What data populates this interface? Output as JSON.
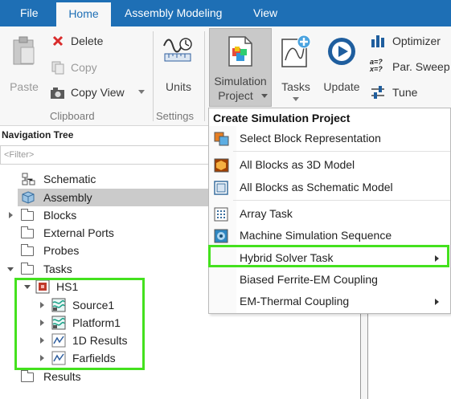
{
  "menubar": {
    "file": "File",
    "home": "Home",
    "assembly_modeling": "Assembly Modeling",
    "view": "View"
  },
  "ribbon": {
    "paste": "Paste",
    "delete": "Delete",
    "copy": "Copy",
    "copy_view": "Copy View",
    "clipboard_group": "Clipboard",
    "units": "Units",
    "settings_group": "Settings",
    "simulation_project_line1": "Simulation",
    "simulation_project_line2": "Project",
    "tasks": "Tasks",
    "update": "Update",
    "optimizer": "Optimizer",
    "par_sweep": "Par. Sweep",
    "tune": "Tune",
    "par_sweep_glyph": "a=?\nx=?"
  },
  "nav": {
    "title": "Navigation Tree",
    "filter_placeholder": "<Filter>",
    "items": {
      "schematic": "Schematic",
      "assembly": "Assembly",
      "blocks": "Blocks",
      "external_ports": "External Ports",
      "probes": "Probes",
      "tasks": "Tasks",
      "hs1": "HS1",
      "source1": "Source1",
      "platform1": "Platform1",
      "results_1d": "1D Results",
      "farfields": "Farfields",
      "results": "Results"
    }
  },
  "dropdown": {
    "title": "Create Simulation Project",
    "items": [
      {
        "label": "Select Block Representation",
        "submenu": false
      },
      {
        "label": "All Blocks as 3D Model",
        "submenu": false
      },
      {
        "label": "All Blocks as Schematic Model",
        "submenu": false
      },
      {
        "label": "Array Task",
        "submenu": false
      },
      {
        "label": "Machine Simulation Sequence",
        "submenu": false
      },
      {
        "label": "Hybrid Solver Task",
        "submenu": true
      },
      {
        "label": "Biased Ferrite-EM Coupling",
        "submenu": false
      },
      {
        "label": "EM-Thermal Coupling",
        "submenu": true
      }
    ]
  },
  "colors": {
    "menubar": "#1e6fb5",
    "highlight": "#44e11e",
    "selection": "#cbcbcb"
  }
}
